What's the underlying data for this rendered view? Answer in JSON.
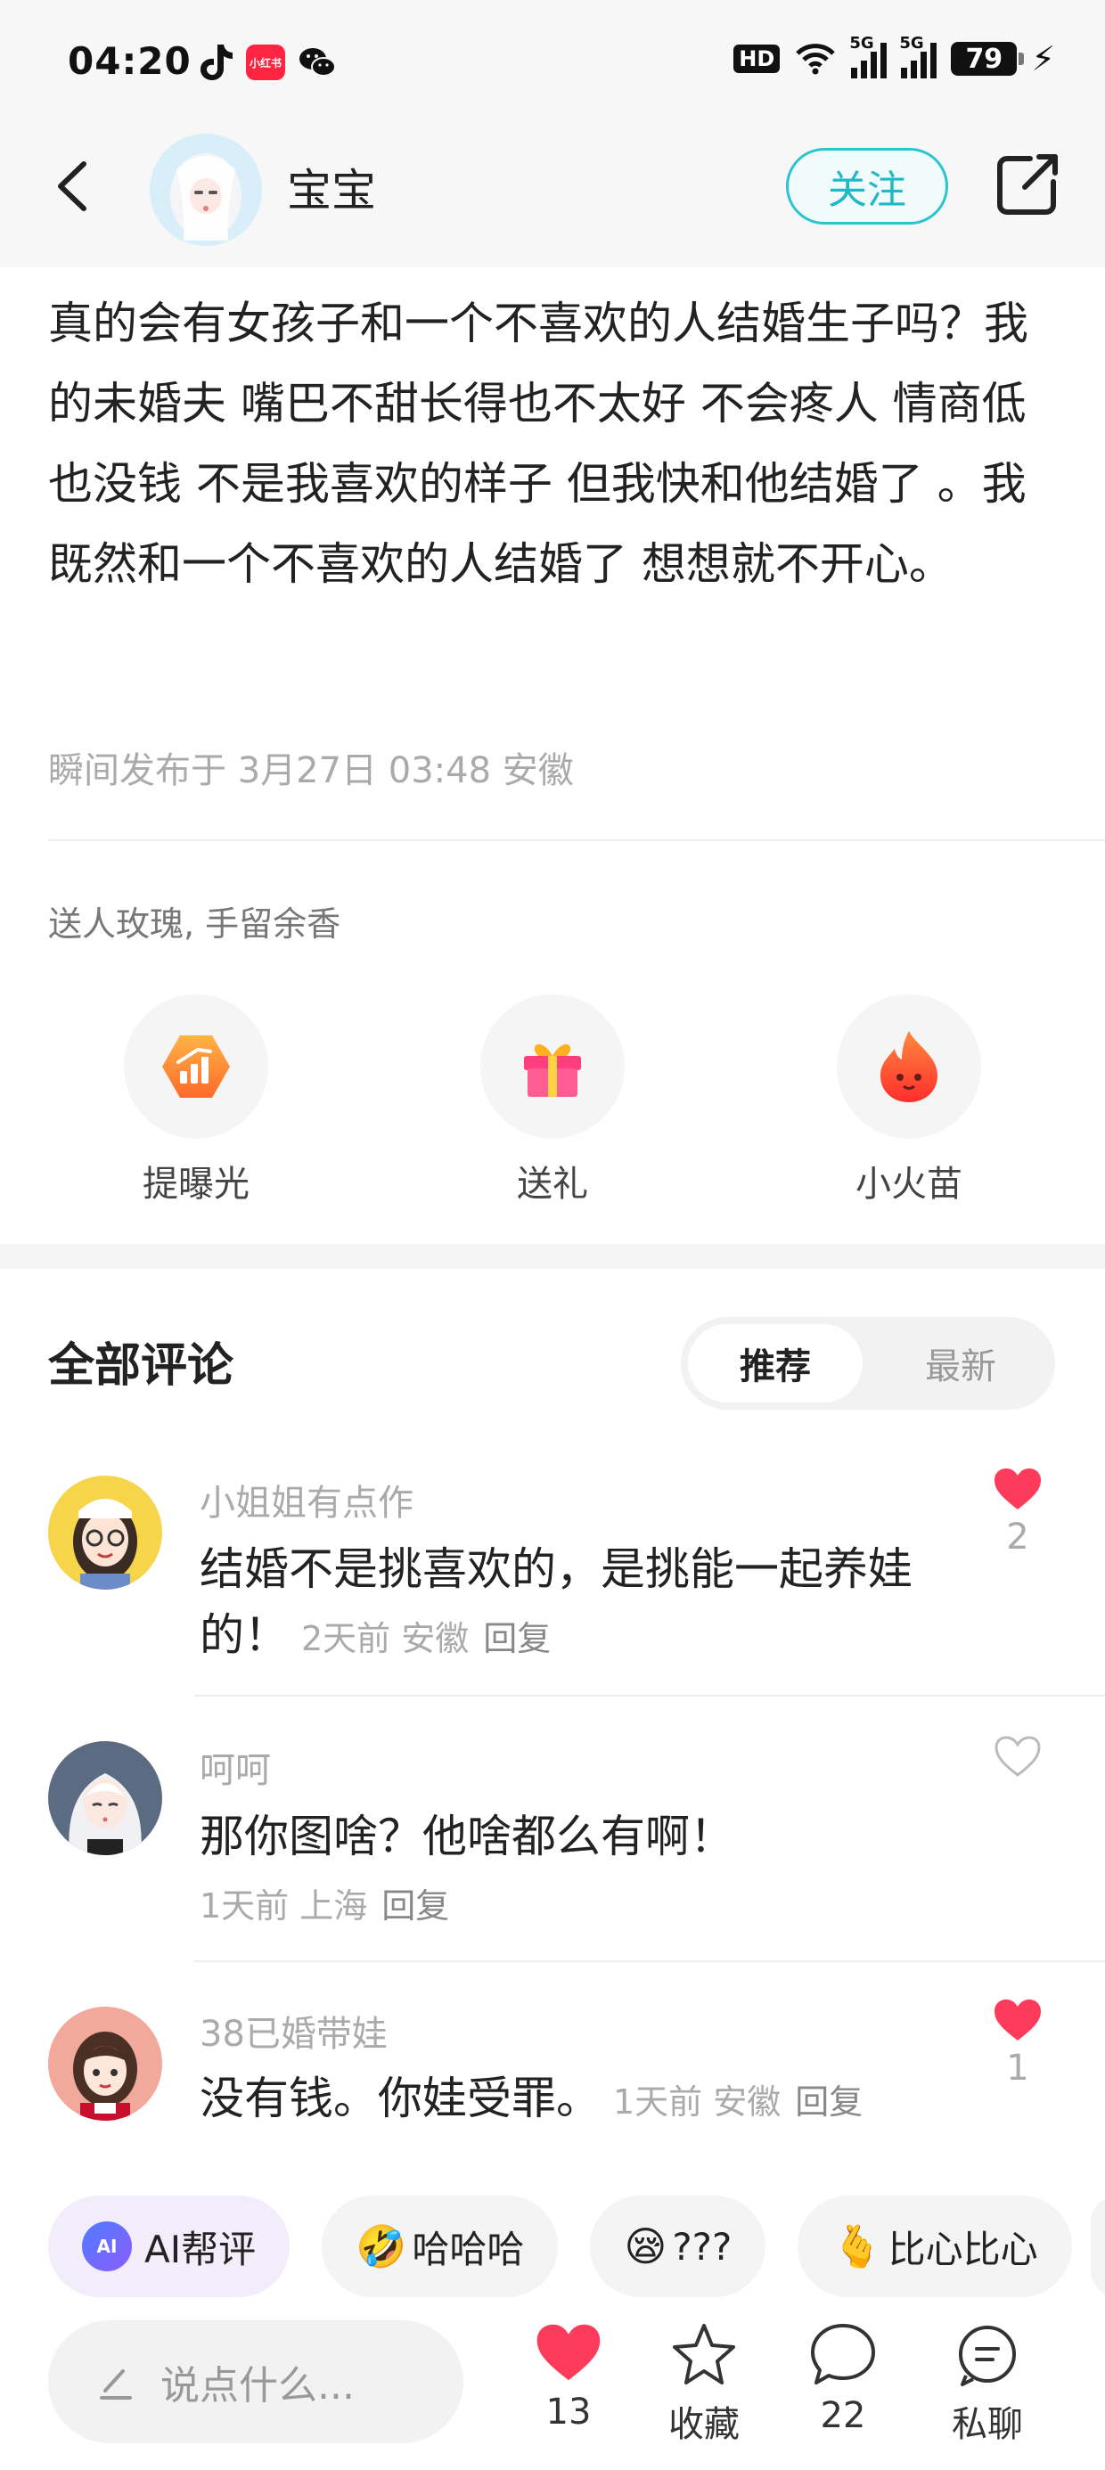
{
  "status_bar": {
    "time": "04:20",
    "xhs_label": "小红书",
    "hd": "HD",
    "hd_sub": "1\n2",
    "net1": "5G",
    "net2": "5G",
    "battery": "79"
  },
  "header": {
    "username": "宝宝",
    "follow_label": "关注"
  },
  "post": {
    "text": "真的会有女孩子和一个不喜欢的人结婚生子吗？我的未婚夫 嘴巴不甜长得也不太好 不会疼人 情商低 也没钱 不是我喜欢的样子 但我快和他结婚了 。我既然和一个不喜欢的人结婚了 想想就不开心。",
    "meta": "瞬间发布于 3月27日 03:48 安徽"
  },
  "gifts": {
    "caption": "送人玫瑰, 手留余香",
    "actions": [
      {
        "label": "提曝光",
        "icon": "boost-icon"
      },
      {
        "label": "送礼",
        "icon": "gift-icon"
      },
      {
        "label": "小火苗",
        "icon": "flame-icon"
      }
    ]
  },
  "comments_section": {
    "title": "全部评论",
    "sort_active": "推荐",
    "sort_inactive": "最新"
  },
  "comments": [
    {
      "user": "小姐姐有点作",
      "text": "结婚不是挑喜欢的，是挑能一起养娃的！",
      "time": "2天前",
      "location": "安徽",
      "reply": "回复",
      "likes": "2",
      "liked": true
    },
    {
      "user": "呵呵",
      "text": "那你图啥？他啥都么有啊！",
      "time": "1天前",
      "location": "上海",
      "reply": "回复",
      "likes": "",
      "liked": false
    },
    {
      "user": "38已婚带娃",
      "text": "没有钱。你娃受罪。",
      "time": "1天前",
      "location": "安徽",
      "reply": "回复",
      "likes": "1",
      "liked": true
    }
  ],
  "chips": [
    {
      "label": "AI帮评",
      "emoji": ""
    },
    {
      "label": "哈哈哈",
      "emoji": "🤣"
    },
    {
      "label": "???",
      "emoji": "😪"
    },
    {
      "label": "比心比心",
      "emoji": "🫰"
    }
  ],
  "bottom_bar": {
    "input_placeholder": "说点什么...",
    "like_count": "13",
    "collect_label": "收藏",
    "comment_count": "22",
    "message_label": "私聊"
  },
  "colors": {
    "accent": "#1fb8c4",
    "like_red": "#ff3b5c"
  }
}
